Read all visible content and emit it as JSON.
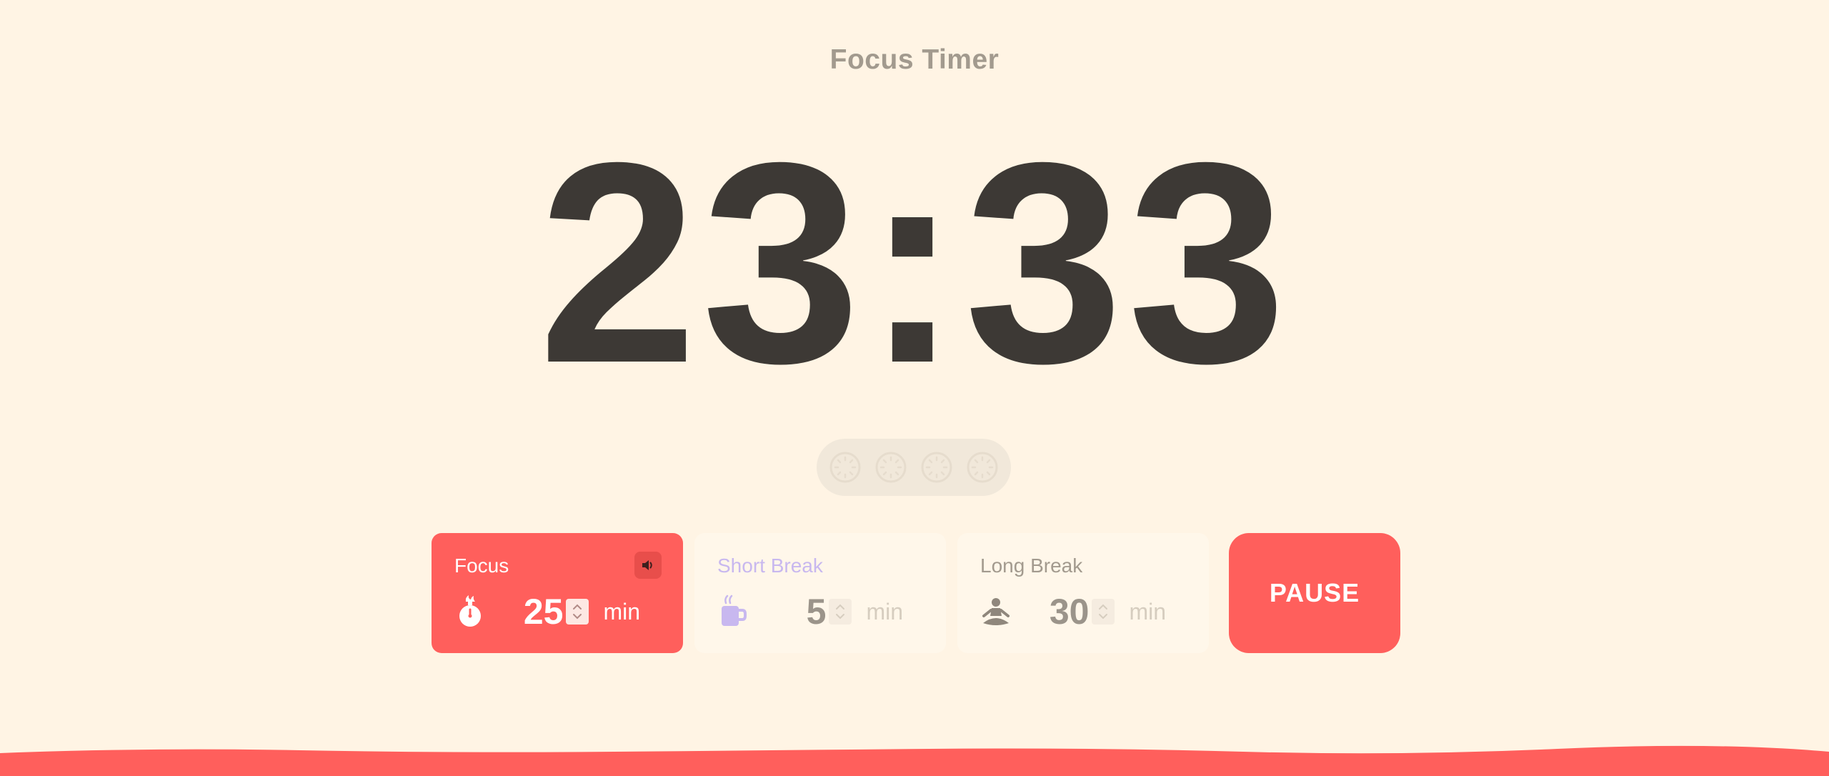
{
  "app": {
    "title": "Focus Timer"
  },
  "timer": {
    "display": "23:33"
  },
  "sessions": {
    "count": 4,
    "completed": 0
  },
  "modes": [
    {
      "key": "focus",
      "label": "Focus",
      "value": "25",
      "unit": "min",
      "icon": "stopwatch-fire-icon",
      "active": true
    },
    {
      "key": "short",
      "label": "Short Break",
      "value": "5",
      "unit": "min",
      "icon": "coffee-mug-icon",
      "active": false
    },
    {
      "key": "long",
      "label": "Long Break",
      "value": "30",
      "unit": "min",
      "icon": "meditation-icon",
      "active": false
    }
  ],
  "controls": {
    "pause_label": "PAUSE",
    "sound_icon": "speaker-icon"
  },
  "colors": {
    "background": "#fff4e4",
    "accent": "#ff5f5c",
    "timer_text": "#3d3935",
    "muted_text": "#a29a8e",
    "short_break_label": "#c8b8ef"
  }
}
